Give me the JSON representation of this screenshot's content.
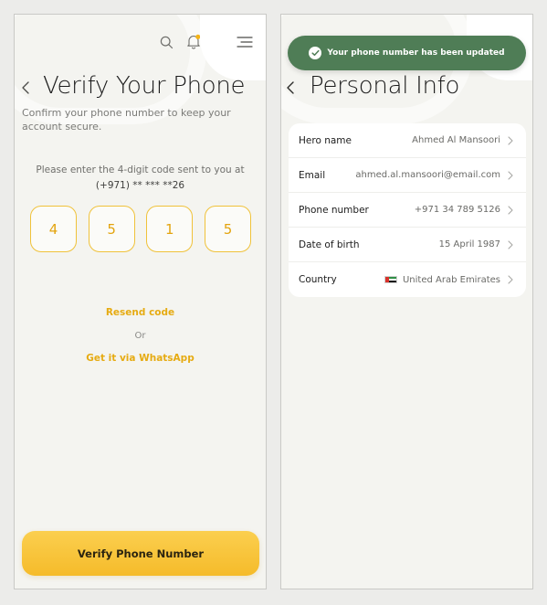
{
  "verify_screen": {
    "title": "Verify Your Phone",
    "subtitle": "Confirm your phone number to keep your account secure.",
    "prompt_line1": "Please enter the 4-digit code sent to you at",
    "prompt_line2": "(+971) ** *** **26",
    "code_digits": [
      "4",
      "5",
      "1",
      "5"
    ],
    "resend_label": "Resend code",
    "or_label": "Or",
    "whatsapp_label": "Get it via WhatsApp",
    "verify_button_label": "Verify Phone Number",
    "icons": {
      "back": "chevron-left-icon",
      "search": "search-icon",
      "notification": "bell-icon",
      "menu": "menu-icon"
    }
  },
  "personal_info_screen": {
    "toast_message": "Your phone number has been updated",
    "title": "Personal Info",
    "rows": [
      {
        "label": "Hero name",
        "value": "Ahmed Al Mansoori"
      },
      {
        "label": "Email",
        "value": "ahmed.al.mansoori@email.com"
      },
      {
        "label": "Phone number",
        "value": "+971 34 789 5126"
      },
      {
        "label": "Date of birth",
        "value": "15 April 1987"
      },
      {
        "label": "Country",
        "value": "United Arab Emirates",
        "flag": "uae-flag-icon"
      }
    ]
  },
  "colors": {
    "accent_yellow": "#f5bb2a",
    "code_text": "#e3a40f",
    "link_yellow": "#e6ab12",
    "toast_green": "#4f7d56",
    "notification_dot": "#f5b417",
    "screen_bg": "#f4f4f0"
  }
}
